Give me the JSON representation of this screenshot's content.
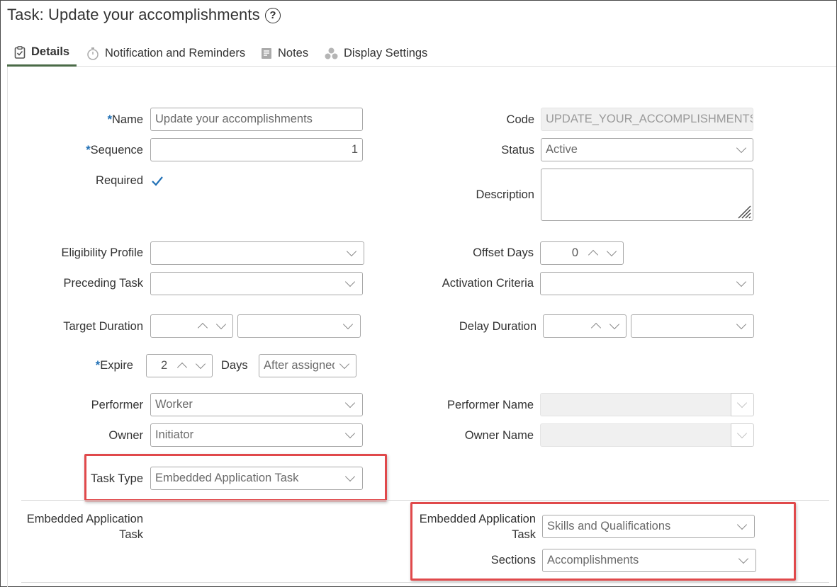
{
  "window": {
    "title": "Task: Update your accomplishments",
    "help_icon": "question-circle-icon"
  },
  "tabs": [
    {
      "label": "Details",
      "icon": "clipboard-check-icon",
      "active": true
    },
    {
      "label": "Notification and Reminders",
      "icon": "stopwatch-icon",
      "active": false
    },
    {
      "label": "Notes",
      "icon": "note-icon",
      "active": false
    },
    {
      "label": "Display Settings",
      "icon": "shapes-icon",
      "active": false
    }
  ],
  "form": {
    "name": {
      "label": "Name",
      "required_mark": "*",
      "value": "Update your accomplishments"
    },
    "sequence": {
      "label": "Sequence",
      "required_mark": "*",
      "value": "1"
    },
    "required": {
      "label": "Required",
      "checked": true
    },
    "code": {
      "label": "Code",
      "value": "UPDATE_YOUR_ACCOMPLISHMENTS"
    },
    "status": {
      "label": "Status",
      "value": "Active"
    },
    "description": {
      "label": "Description",
      "value": ""
    },
    "eligibility_profile": {
      "label": "Eligibility Profile",
      "value": ""
    },
    "offset_days": {
      "label": "Offset Days",
      "value": "0"
    },
    "preceding_task": {
      "label": "Preceding Task",
      "value": ""
    },
    "activation_criteria": {
      "label": "Activation Criteria",
      "value": ""
    },
    "target_duration": {
      "label": "Target Duration",
      "value": "",
      "unit": ""
    },
    "delay_duration": {
      "label": "Delay Duration",
      "value": "",
      "unit": ""
    },
    "expire": {
      "label": "Expire",
      "required_mark": "*",
      "value": "2",
      "unit_label": "Days",
      "relative_to": "After assigned"
    },
    "performer": {
      "label": "Performer",
      "value": "Worker"
    },
    "performer_name": {
      "label": "Performer Name",
      "value": ""
    },
    "owner": {
      "label": "Owner",
      "value": "Initiator"
    },
    "owner_name": {
      "label": "Owner Name",
      "value": ""
    },
    "task_type": {
      "label": "Task Type",
      "value": "Embedded Application Task"
    }
  },
  "embedded_section": {
    "heading_line1": "Embedded Application",
    "heading_line2": "Task",
    "task_label_line1": "Embedded Application",
    "task_label_line2": "Task",
    "task_value": "Skills and Qualifications",
    "sections_label": "Sections",
    "sections_value": "Accomplishments"
  },
  "colors": {
    "highlight": "#e0494b",
    "required_mark": "#1f6fb5",
    "active_tab_underline": "#4a6a47",
    "checkbox_check": "#1f6fb5"
  }
}
